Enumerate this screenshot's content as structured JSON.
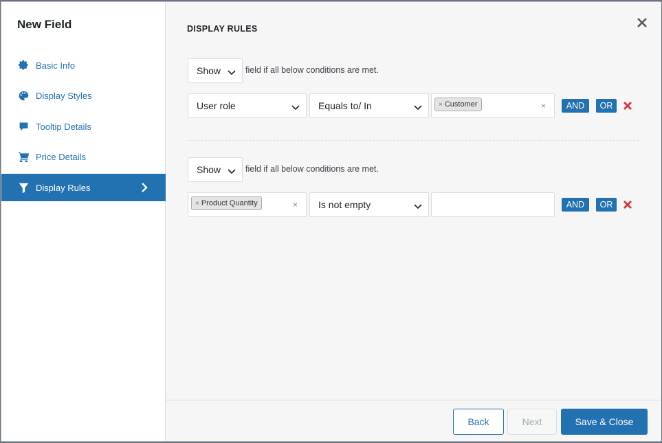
{
  "sidebar": {
    "title": "New Field",
    "items": [
      {
        "label": "Basic Info",
        "icon": "gear-icon"
      },
      {
        "label": "Display Styles",
        "icon": "palette-icon"
      },
      {
        "label": "Tooltip Details",
        "icon": "speech-bubble-icon"
      },
      {
        "label": "Price Details",
        "icon": "cart-icon"
      },
      {
        "label": "Display Rules",
        "icon": "filter-icon",
        "active": true
      }
    ]
  },
  "main": {
    "title": "DISPLAY RULES",
    "rule_groups": [
      {
        "action": "Show",
        "condition_text": "field if all below conditions are met.",
        "condition": {
          "field": "User role",
          "operator": "Equals to/ In",
          "value_tags": [
            "Customer"
          ]
        }
      },
      {
        "action": "Show",
        "condition_text": "field if all below conditions are met.",
        "condition": {
          "field_tags": [
            "Product Quantity"
          ],
          "operator": "Is not empty",
          "value": ""
        }
      }
    ],
    "and_label": "AND",
    "or_label": "OR",
    "tag_remove": "×",
    "clear_symbol": "×"
  },
  "footer": {
    "back_label": "Back",
    "next_label": "Next",
    "save_label": "Save & Close"
  },
  "colors": {
    "accent": "#2271b1",
    "delete": "#d63638"
  }
}
